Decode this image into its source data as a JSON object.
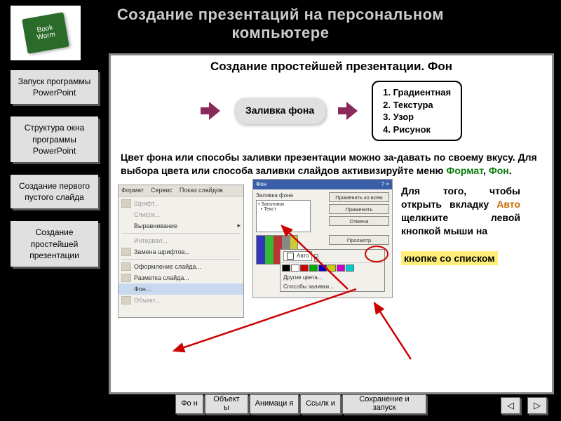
{
  "title_line1": "Создание презентаций на персональном",
  "title_line2": "компьютере",
  "logo_label": "Book Worm",
  "sidebar": [
    "Запуск программы PowerPoint",
    "Структура окна программы PowerPoint",
    "Создание первого пустого слайда",
    "Создание простейшей презентации"
  ],
  "content": {
    "subtitle": "Создание простейшей презентации. Фон",
    "flow_box": "Заливка фона",
    "list_items": [
      "1. Градиентная",
      "2. Текстура",
      "3. Узор",
      "4. Рисунок"
    ],
    "body_prefix": "Цвет фона или способы заливки презентации можно за-давать по своему вкусу. Для выбора цвета или способа заливки слайдов активизируйте меню ",
    "body_kw_format": "Формат",
    "body_comma": ", ",
    "body_kw_fon": "Фон",
    "body_period": ".",
    "side_prefix_1": "Для того, чтобы открыть вкладку ",
    "side_kw_auto": "Авто",
    "side_prefix_2": " щелкните левой кнопкой мыши на",
    "side_callout": "кнопке со списком"
  },
  "menu_shot": {
    "tabs": [
      "Формат",
      "Сервис",
      "Показ слайдов"
    ],
    "items": [
      {
        "label": "Шрифт...",
        "dim": true,
        "hasIcon": true
      },
      {
        "label": "Список...",
        "dim": true
      },
      {
        "label": "Выравнивание",
        "arrow": true
      },
      {
        "label": "Интервал...",
        "dim": true
      },
      {
        "label": "Замена шрифтов...",
        "hasIcon": true
      },
      {
        "label": "Оформление слайда...",
        "hasIcon": true
      },
      {
        "label": "Разметка слайда...",
        "hasIcon": true
      },
      {
        "label": "Фон...",
        "selected": true
      },
      {
        "label": "Объект...",
        "dim": true,
        "hasIcon": true
      }
    ],
    "sep_before": [
      3,
      5
    ]
  },
  "dialog_shot": {
    "title": "Фон",
    "label": "Заливка фона",
    "chk1": "Заголовок",
    "chk2": "Текст",
    "buttons": [
      "Применить ко всем",
      "Применить",
      "Отмена",
      "Просмотр"
    ],
    "popover": {
      "auto": "Авто",
      "line1": "Другие цвета...",
      "line2": "Способы заливки..."
    }
  },
  "tabs": [
    "Фо н",
    "Объект ы",
    "Анимаци я",
    "Ссылк и",
    "Сохранение и запуск"
  ],
  "pager": {
    "prev": "◁",
    "next": "▷"
  }
}
